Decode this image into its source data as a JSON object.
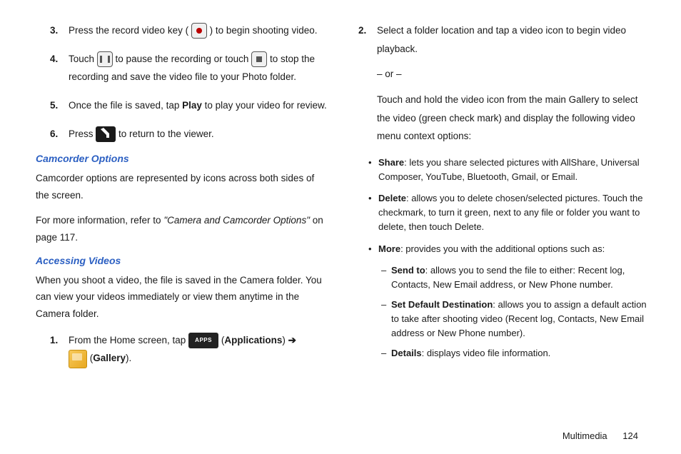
{
  "left": {
    "step3a": "Press the record video key (",
    "step3b": ") to begin shooting video.",
    "step4a": "Touch ",
    "step4b": " to pause the recording or touch ",
    "step4c": " to stop the recording and save the video file to your Photo folder.",
    "step5a": "Once the file is saved, tap ",
    "step5_play": "Play",
    "step5b": " to play your video for review.",
    "step6a": "Press ",
    "step6b": " to return to the viewer.",
    "head_cam": "Camcorder Options",
    "cam_para": "Camcorder options are represented by icons across both sides of the screen.",
    "ref_a": "For more information, refer to ",
    "ref_ital": "\"Camera and Camcorder Options\"",
    "ref_b": " on page 117.",
    "head_acc": "Accessing Videos",
    "acc_para": "When you shoot a video, the file is saved in the Camera folder. You can view your videos immediately or view them anytime in the Camera folder.",
    "step1a": "From the Home screen, tap ",
    "step1_apps_paren": "(",
    "step1_apps": "Applications",
    "step1_apps_close": ") ",
    "apps_icon_text": "APPS",
    "arrow": "➔",
    "step1_gal_paren": " (",
    "step1_gal": "Gallery",
    "step1_gal_close": ")."
  },
  "right": {
    "step2a": "Select a folder location and tap a video icon to begin video playback.",
    "or": "– or –",
    "step2b": "Touch and hold the video icon from the main Gallery to select the video (green check mark) and display the following video menu context options:",
    "share_b": "Share",
    "share_t": ": lets you share selected pictures with AllShare, Universal Composer, YouTube, Bluetooth, Gmail, or Email.",
    "delete_b": "Delete",
    "delete_t": ": allows you to delete chosen/selected pictures. Touch the checkmark, to turn it green, next to any file or folder you want to delete, then touch Delete.",
    "more_b": "More",
    "more_t": ": provides you with the additional options such as:",
    "sendto_b": "Send to",
    "sendto_t": ": allows you to send the file to either: Recent log, Contacts, New Email address, or New Phone number.",
    "setdef_b": "Set Default Destination",
    "setdef_t": ": allows you to assign a default action to take after shooting video (Recent log, Contacts, New Email address or New Phone number).",
    "details_b": "Details",
    "details_t": ": displays video file information."
  },
  "footer": {
    "section": "Multimedia",
    "page": "124"
  },
  "nums": {
    "n1": "1.",
    "n2": "2.",
    "n3": "3.",
    "n4": "4.",
    "n5": "5.",
    "n6": "6."
  }
}
